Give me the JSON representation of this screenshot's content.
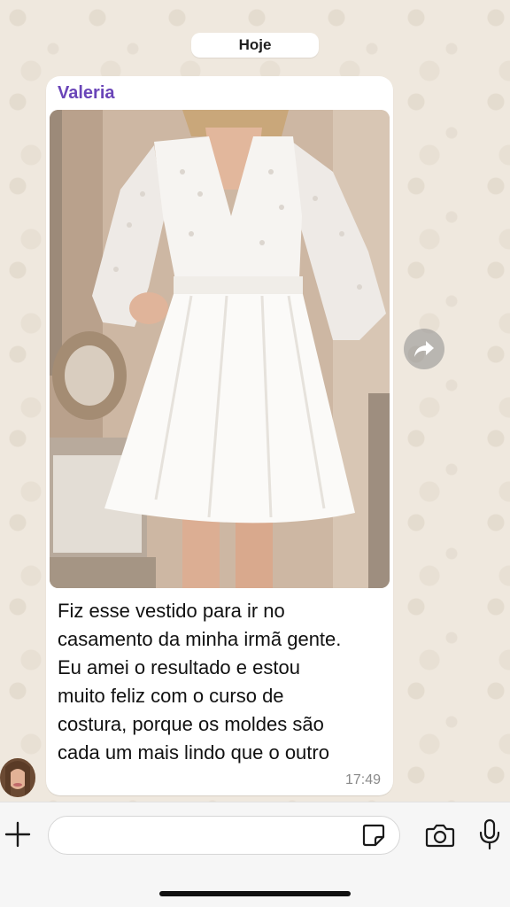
{
  "chat": {
    "date_label": "Hoje",
    "message": {
      "sender": "Valeria",
      "image_alt": "white lace dress",
      "text": "Fiz esse vestido para ir no\ncasamento da minha irmã gente.\nEu amei o resultado e estou\nmuito feliz com o curso de\ncostura, porque os moldes são\ncada um mais lindo que o outro",
      "time": "17:49"
    }
  },
  "composer": {
    "value": "",
    "placeholder": ""
  },
  "icons": {
    "forward": "forward-arrow-icon",
    "plus": "plus-icon",
    "sticker": "sticker-icon",
    "camera": "camera-icon",
    "mic": "microphone-icon"
  },
  "colors": {
    "sender_name": "#6a45b8",
    "bubble": "#ffffff",
    "wallpaper": "#efe8de",
    "timestamp": "#8a8a8a"
  }
}
